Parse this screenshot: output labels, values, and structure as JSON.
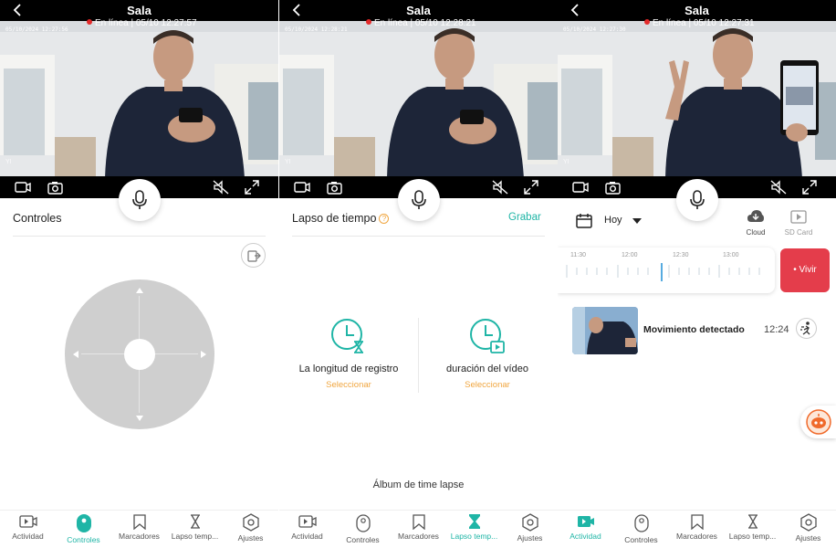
{
  "screens": [
    {
      "title": "Sala",
      "status": "En línea | 05/10 12:27:57",
      "osd_time": "05/10/2024  12:27:56",
      "watermark": "YI",
      "section_title": "Controles",
      "active_tab": "Controles"
    },
    {
      "title": "Sala",
      "status": "En línea | 05/10 12:28:21",
      "osd_time": "05/10/2024  12:28:21",
      "watermark": "YI",
      "section_title": "Lapso de tiempo",
      "help_glyph": "?",
      "record_label": "Grabar",
      "options": [
        {
          "label": "La longitud de registro",
          "action": "Seleccionar"
        },
        {
          "label": "duración del vídeo",
          "action": "Seleccionar"
        }
      ],
      "album_label": "Álbum de time lapse",
      "active_tab": "Lapso temp..."
    },
    {
      "title": "Sala",
      "status": "En línea | 05/10 12:27:31",
      "osd_time": "05/10/2024  12:27:30",
      "watermark": "YI",
      "day_label": "Hoy",
      "sources": [
        "Cloud",
        "SD Card"
      ],
      "timeline_labels": [
        "11:30",
        "12:00",
        "12:30",
        "13:00"
      ],
      "live_label": "• Vivir",
      "events": [
        {
          "label": "Movimiento detectado",
          "time": "12:24"
        }
      ],
      "active_tab": "Actividad"
    }
  ],
  "nav": {
    "tabs_s1": [
      "Actividad",
      "Controles",
      "Marcadores",
      "Lapso temp...",
      "Ajustes"
    ],
    "tabs_s2": [
      "Actividad",
      "Controles",
      "Marcadores",
      "Lapso temp...",
      "Ajustes"
    ],
    "tabs_s3": [
      "Actividad",
      "Controles",
      "Marcadores",
      "Lapso temp...",
      "Ajustes"
    ]
  },
  "colors": {
    "accent": "#1fb5a6",
    "orange": "#f0a640",
    "live_red": "#e43d4b",
    "status_dot": "#e32b2b",
    "joystick": "#cfcfcf"
  }
}
